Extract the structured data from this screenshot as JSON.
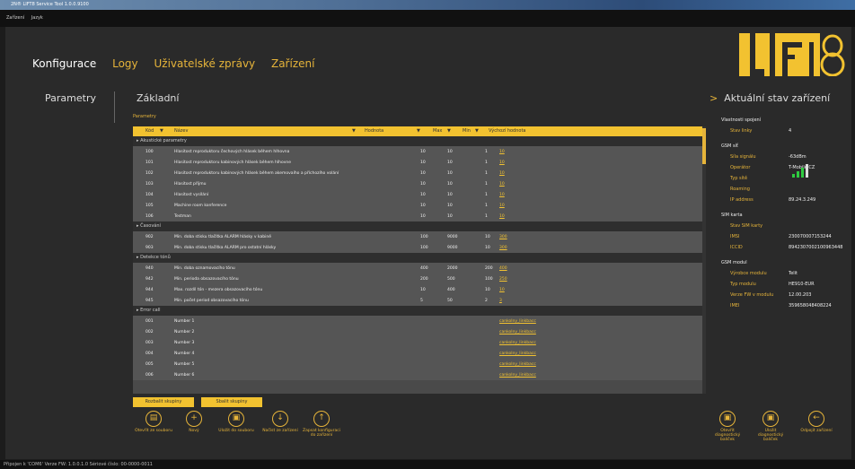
{
  "window": {
    "title": "2N® LIFT8 Service Tool 1.0.0.9100"
  },
  "menu": [
    "Zařízení",
    "Jazyk"
  ],
  "nav": [
    {
      "label": "Konfigurace"
    },
    {
      "label": "Logy"
    },
    {
      "label": "Uživatelské zprávy"
    },
    {
      "label": "Zařízení"
    }
  ],
  "brand": {
    "logo": "LIFT8",
    "accent": "#f2c230"
  },
  "left_panel": {
    "title": "Parametry"
  },
  "center": {
    "title": "Základní",
    "table_label": "Parametry"
  },
  "table": {
    "headers": {
      "code": "Kód",
      "name": "Název",
      "value": "Hodnota",
      "max": "Max",
      "min": "Min",
      "default": "Výchozí hodnota"
    },
    "groups": [
      {
        "name": "Akustické parametry",
        "rows": [
          {
            "code": "100",
            "name": "Hlasitost reproduktoru čechových hlásek během hlhovna",
            "value": "",
            "max": "10",
            "min": "10",
            "def_min": "1",
            "def": "10"
          },
          {
            "code": "101",
            "name": "Hlasitost reproduktoru kabinových hlásek během hlhovne",
            "value": "",
            "max": "10",
            "min": "10",
            "def_min": "1",
            "def": "10"
          },
          {
            "code": "102",
            "name": "Hlasitost reproduktoru kabinových hlásek během akemovaího a příchozího volání",
            "value": "",
            "max": "10",
            "min": "10",
            "def_min": "1",
            "def": "10"
          },
          {
            "code": "103",
            "name": "Hlasitost příjmu",
            "value": "",
            "max": "10",
            "min": "10",
            "def_min": "1",
            "def": "10"
          },
          {
            "code": "104",
            "name": "Hlasitost vysílání",
            "value": "",
            "max": "10",
            "min": "10",
            "def_min": "1",
            "def": "10"
          },
          {
            "code": "105",
            "name": "Machine room konference",
            "value": "",
            "max": "10",
            "min": "10",
            "def_min": "1",
            "def": "10"
          },
          {
            "code": "106",
            "name": "Testman",
            "value": "",
            "max": "10",
            "min": "10",
            "def_min": "1",
            "def": "10"
          }
        ]
      },
      {
        "name": "Časování",
        "rows": [
          {
            "code": "902",
            "name": "Min. doba stisku tlačítka ALARM hlásky v kabině",
            "value": "",
            "max": "100",
            "min": "9000",
            "def_min": "10",
            "def": "300"
          },
          {
            "code": "903",
            "name": "Min. doba stisku tlačítka ALARM pro ostatní hlásky",
            "value": "",
            "max": "100",
            "min": "9000",
            "def_min": "10",
            "def": "300"
          }
        ]
      },
      {
        "name": "Detekce tónů",
        "rows": [
          {
            "code": "940",
            "name": "Min. doba oznamovacího tónu",
            "value": "",
            "max": "400",
            "min": "2000",
            "def_min": "200",
            "def": "400"
          },
          {
            "code": "942",
            "name": "Min. perioda obsazovacího tónu",
            "value": "",
            "max": "200",
            "min": "500",
            "def_min": "100",
            "def": "250"
          },
          {
            "code": "944",
            "name": "Max. rozdíl tón - mezera obsazovacího tónu",
            "value": "",
            "max": "10",
            "min": "400",
            "def_min": "10",
            "def": "10"
          },
          {
            "code": "945",
            "name": "Min. počet period obsazovacího tónu",
            "value": "",
            "max": "5",
            "min": "50",
            "def_min": "2",
            "def": "3"
          }
        ]
      },
      {
        "name": "Error call",
        "rows": [
          {
            "code": "001",
            "name": "Number 1",
            "value": "",
            "max": "",
            "min": "",
            "def_min": "",
            "def": "cankolny_linkbacc"
          },
          {
            "code": "002",
            "name": "Number 2",
            "value": "",
            "max": "",
            "min": "",
            "def_min": "",
            "def": "cankolny_linkbacc"
          },
          {
            "code": "003",
            "name": "Number 3",
            "value": "",
            "max": "",
            "min": "",
            "def_min": "",
            "def": "cankolny_linkbacc"
          },
          {
            "code": "004",
            "name": "Number 4",
            "value": "",
            "max": "",
            "min": "",
            "def_min": "",
            "def": "cankolny_linkbacc"
          },
          {
            "code": "005",
            "name": "Number 5",
            "value": "",
            "max": "",
            "min": "",
            "def_min": "",
            "def": "cankolny_linkbacc"
          },
          {
            "code": "006",
            "name": "Number 6",
            "value": "",
            "max": "",
            "min": "",
            "def_min": "",
            "def": "cankolny_linkbacc"
          }
        ]
      }
    ]
  },
  "group_buttons": {
    "expand": "Rozbalit skupiny",
    "collapse": "Sbalit skupiny"
  },
  "actions": [
    {
      "label": "Otevřít ze souboru",
      "icon": "open-file-icon",
      "glyph": "▤"
    },
    {
      "label": "Nový",
      "icon": "plus-icon",
      "glyph": "+"
    },
    {
      "label": "Uložit do souboru",
      "icon": "save-file-icon",
      "glyph": "▣"
    },
    {
      "label": "Načíst ze zařízení",
      "icon": "download-icon",
      "glyph": "↓"
    },
    {
      "label": "Zapsat konfiguraci do zařízení",
      "icon": "upload-icon",
      "glyph": "↑"
    }
  ],
  "right_actions": [
    {
      "label": "Otevřít diagnostický balíček",
      "icon": "open-package-icon",
      "glyph": "▣"
    },
    {
      "label": "Uložit diagnostický balíček",
      "icon": "save-package-icon",
      "glyph": "▣"
    },
    {
      "label": "Odpojit zařízení",
      "icon": "disconnect-icon",
      "glyph": "←"
    }
  ],
  "right_panel": {
    "title": "Aktuální stav zařízení",
    "sections": [
      {
        "title": "Vlastnosti spojení",
        "items": [
          {
            "k": "Stav linky",
            "v": "4"
          }
        ]
      },
      {
        "title": "GSM síť",
        "items": [
          {
            "k": "Síla signálu",
            "v": "-63dBm"
          },
          {
            "k": "Operátor",
            "v": "T-Mobile CZ"
          },
          {
            "k": "Typ sítě",
            "v": ""
          },
          {
            "k": "Roaming",
            "v": ""
          },
          {
            "k": "IP address",
            "v": "89.24.3.249"
          }
        ]
      },
      {
        "title": "SIM karta",
        "items": [
          {
            "k": "Stav SIM karty",
            "v": ""
          },
          {
            "k": "IMSI",
            "v": "230070007153244"
          },
          {
            "k": "ICCID",
            "v": "8942307002100963448"
          }
        ]
      },
      {
        "title": "GSM modul",
        "items": [
          {
            "k": "Výrobce modulu",
            "v": "Telit"
          },
          {
            "k": "Typ modulu",
            "v": "HE910-EUR"
          },
          {
            "k": "Verze FW v modulu",
            "v": "12.00.203"
          },
          {
            "k": "IMEI",
            "v": "359658048408224"
          }
        ]
      }
    ]
  },
  "status": {
    "text": "Připojen k 'COM6' Verze FW: 1.0.0.1.0 Sériové číslo: 00-0000-0011"
  }
}
